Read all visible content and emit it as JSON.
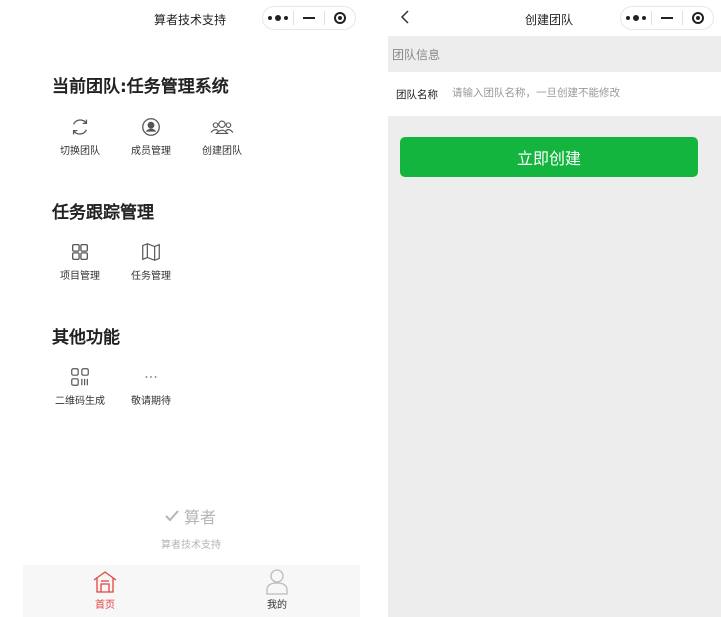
{
  "home": {
    "nav_title": "算者技术支持",
    "sections": [
      {
        "title": "当前团队:任务管理系统",
        "items": [
          {
            "label": "切换团队",
            "icon": "refresh-icon"
          },
          {
            "label": "成员管理",
            "icon": "user-circle-icon"
          },
          {
            "label": "创建团队",
            "icon": "group-icon"
          }
        ]
      },
      {
        "title": "任务跟踪管理",
        "items": [
          {
            "label": "项目管理",
            "icon": "grid-icon"
          },
          {
            "label": "任务管理",
            "icon": "map-icon"
          }
        ]
      },
      {
        "title": "其他功能",
        "items": [
          {
            "label": "二维码生成",
            "icon": "qrcode-icon"
          },
          {
            "label": "敬请期待",
            "icon": "more-dots-icon"
          }
        ]
      }
    ],
    "brand_name": "算者",
    "support_text": "算者技术支持",
    "tabs": [
      {
        "label": "首页",
        "icon": "home-icon",
        "active": true,
        "color": "#e64340"
      },
      {
        "label": "我的",
        "icon": "person-icon",
        "active": false,
        "color": "#333333"
      }
    ]
  },
  "create_team": {
    "nav_title": "创建团队",
    "group_header": "团队信息",
    "field_label": "团队名称",
    "field_value": "",
    "field_placeholder": "请输入团队名称，一旦创建不能修改",
    "submit_label": "立即创建",
    "accent_color": "#13b53e"
  }
}
